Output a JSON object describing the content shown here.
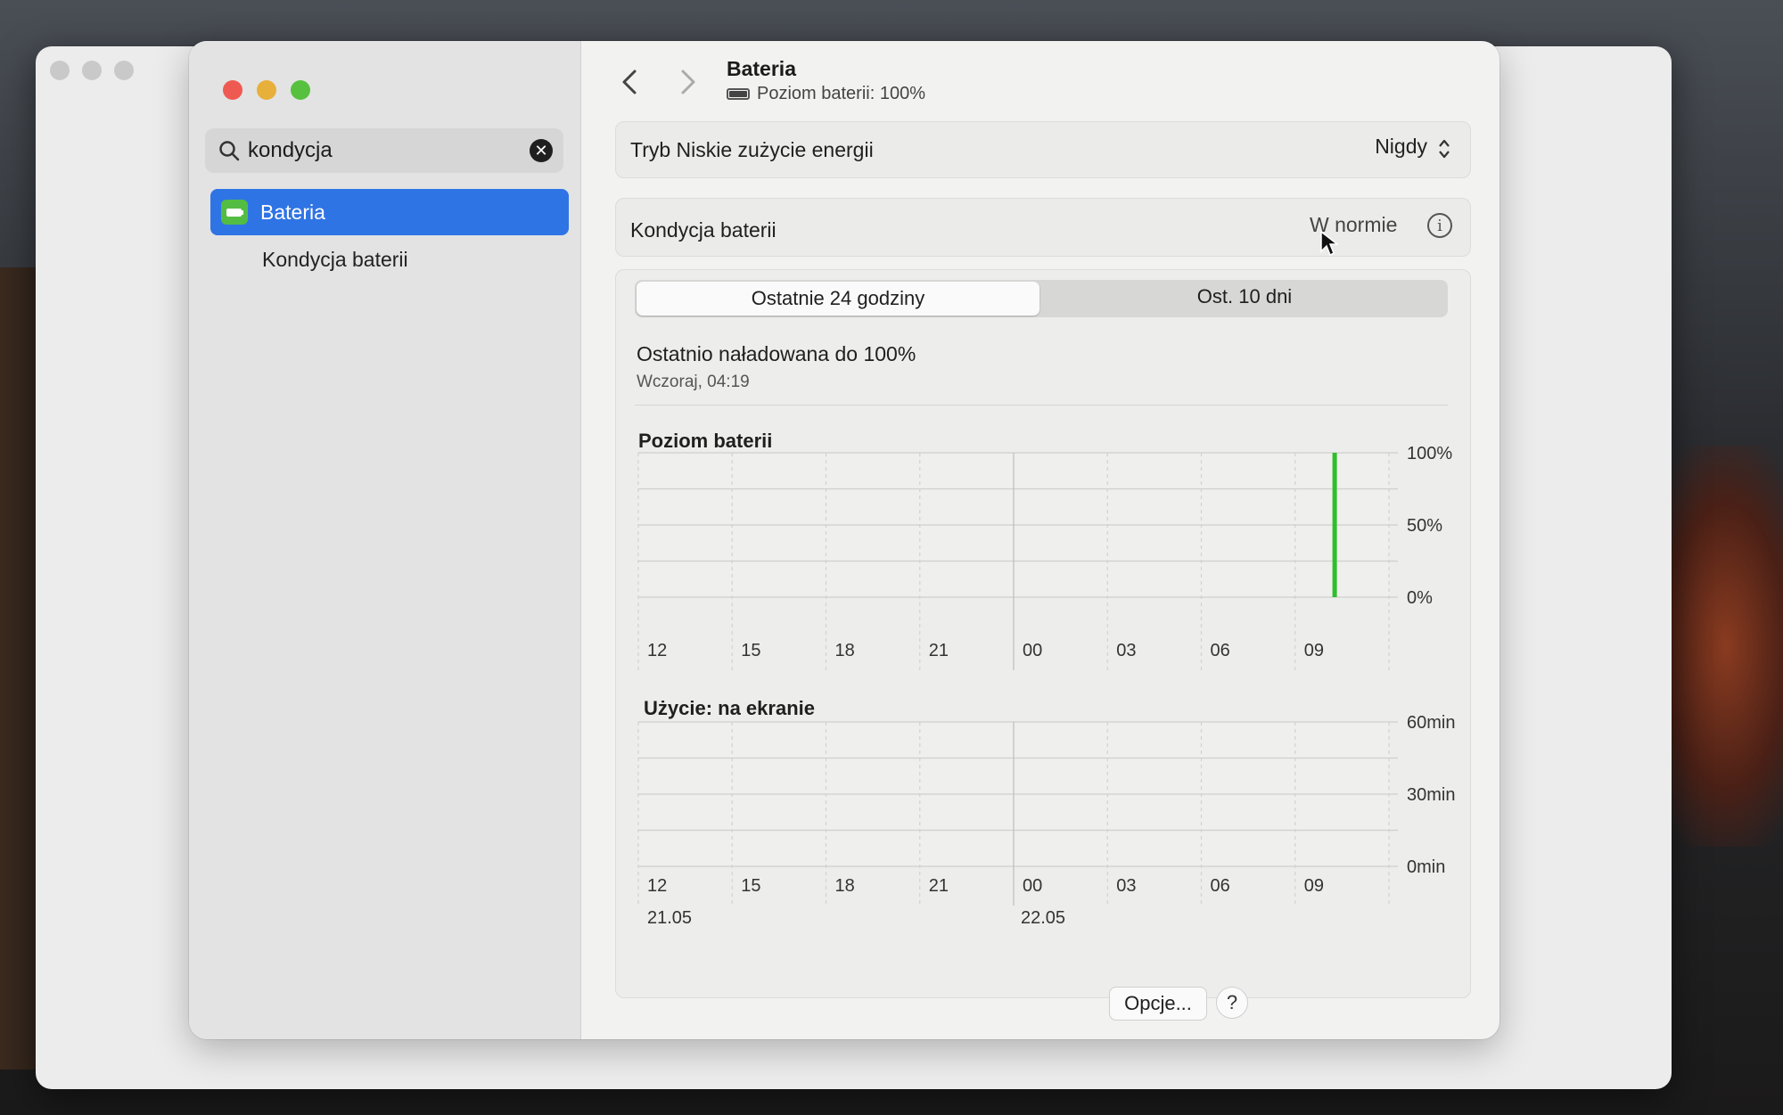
{
  "window": {
    "title": "Bateria",
    "subtitle": "Poziom baterii: 100%"
  },
  "sidebar": {
    "search_value": "kondycja",
    "items": [
      {
        "label": "Bateria",
        "selected": true,
        "icon": "battery-icon"
      },
      {
        "label": "Kondycja baterii",
        "selected": false
      }
    ]
  },
  "settings": {
    "low_power_label": "Tryb Niskie zużycie energii",
    "low_power_value": "Nigdy",
    "health_label": "Kondycja baterii",
    "health_value": "W normie"
  },
  "tabs": {
    "active": "Ostatnie 24 godziny",
    "inactive": "Ost. 10 dni"
  },
  "last_charged": {
    "label": "Ostatnio naładowana do 100%",
    "time": "Wczoraj, 04:19"
  },
  "charts": {
    "battery_title": "Poziom baterii",
    "usage_title": "Użycie: na ekranie"
  },
  "chart_data": [
    {
      "type": "bar",
      "title": "Poziom baterii",
      "x_ticks": [
        "12",
        "15",
        "18",
        "21",
        "00",
        "03",
        "06",
        "09"
      ],
      "y_ticks": [
        "100%",
        "50%",
        "0%"
      ],
      "ylim": [
        0,
        100
      ],
      "series": [
        {
          "values": [
            {
              "x": "10:15",
              "y": 100
            }
          ],
          "color": "#2fbf2a"
        }
      ],
      "grid": true
    },
    {
      "type": "bar",
      "title": "Użycie: na ekranie",
      "x_ticks": [
        "12",
        "15",
        "18",
        "21",
        "00",
        "03",
        "06",
        "09"
      ],
      "date_labels": [
        "21.05",
        "22.05"
      ],
      "y_ticks": [
        "60min",
        "30min",
        "0min"
      ],
      "ylim": [
        0,
        60
      ],
      "series": [],
      "grid": true
    }
  ],
  "footer": {
    "options_label": "Opcje...",
    "help_label": "?"
  },
  "colors": {
    "accent": "#2f74e4",
    "battery_green": "#2fbf2a"
  }
}
